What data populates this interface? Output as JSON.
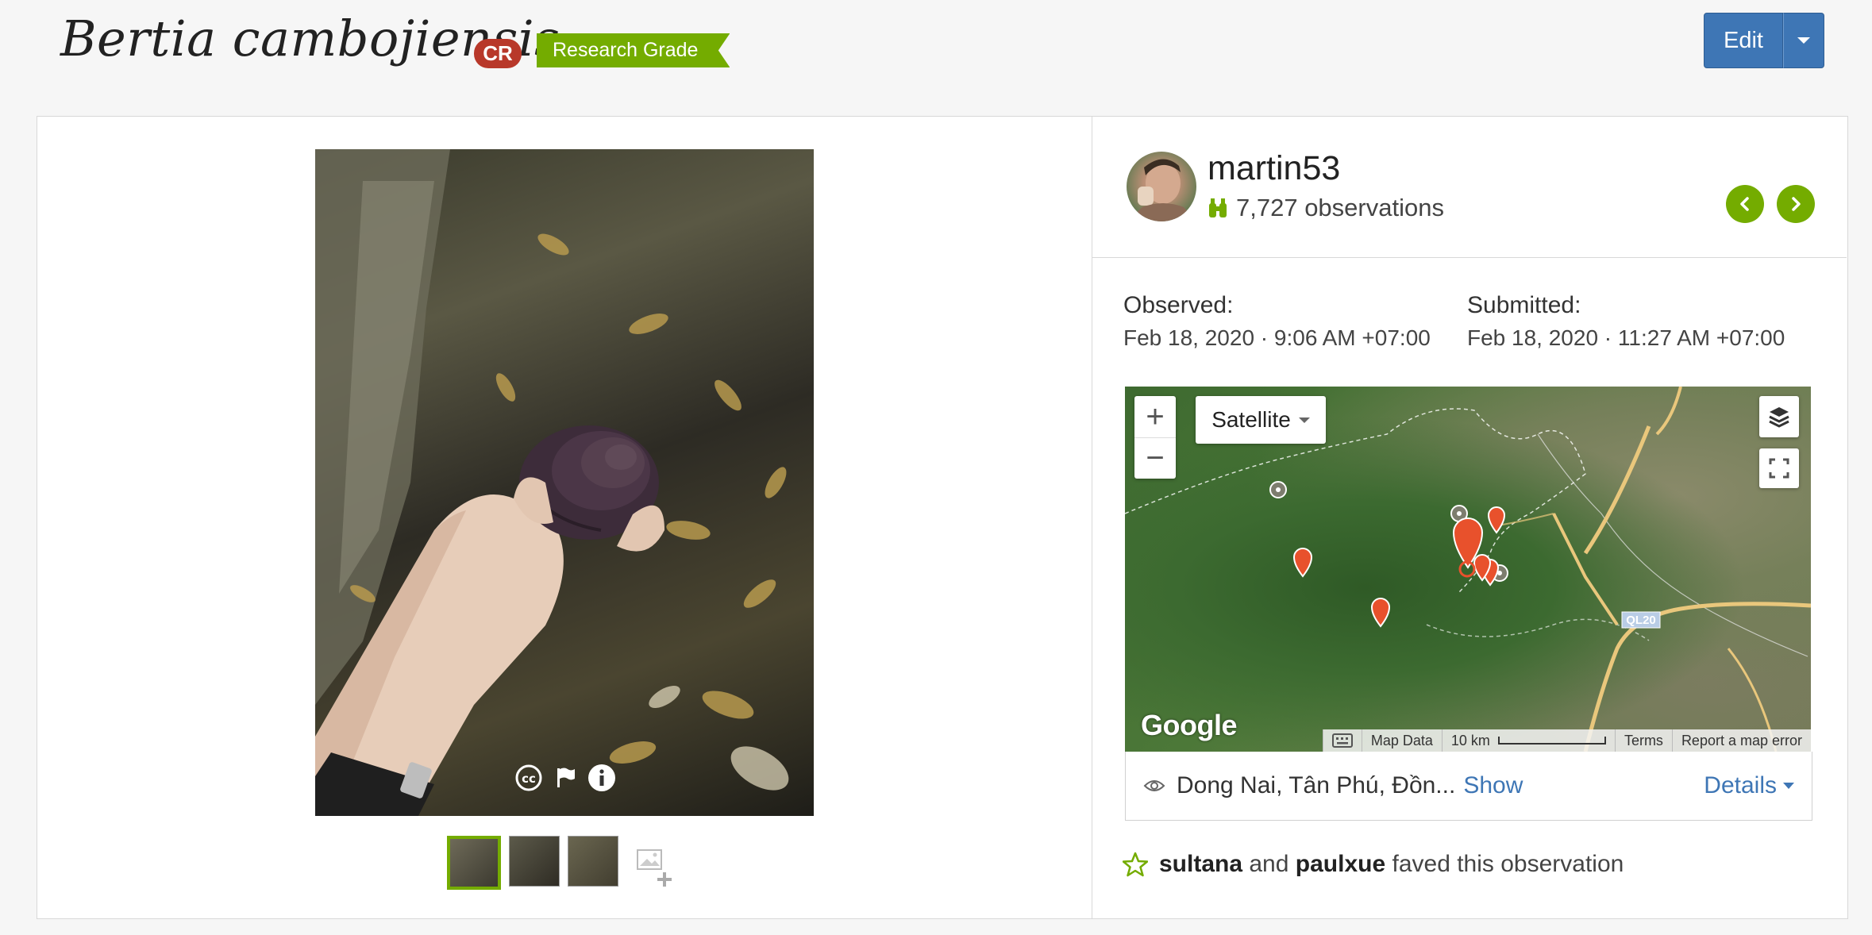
{
  "header": {
    "taxon_name": "Bertia cambojiensis",
    "iucn_status": "CR",
    "quality_grade": "Research Grade",
    "edit_label": "Edit"
  },
  "user": {
    "username": "martin53",
    "observations": "7,727 observations"
  },
  "dates": {
    "observed_label": "Observed:",
    "observed_value": "Feb 18, 2020 · 9:06 AM +07:00",
    "submitted_label": "Submitted:",
    "submitted_value": "Feb 18, 2020 · 11:27 AM +07:00"
  },
  "map": {
    "map_type": "Satellite",
    "zoom_in": "+",
    "zoom_out": "−",
    "road_label": "QL20",
    "logo": "Google",
    "footer": {
      "map_data": "Map Data",
      "scale": "10 km",
      "terms": "Terms",
      "report": "Report a map error"
    }
  },
  "location": {
    "place": "Dong Nai, Tân Phú, Đồn...",
    "show_label": "Show",
    "details_label": "Details"
  },
  "faves": {
    "user1": "sultana",
    "and": "and",
    "user2": "paulxue",
    "suffix": "faved this observation"
  },
  "colors": {
    "accent_green": "#74ac00",
    "link_blue": "#3e76b5",
    "iucn_red": "#b8382a"
  }
}
